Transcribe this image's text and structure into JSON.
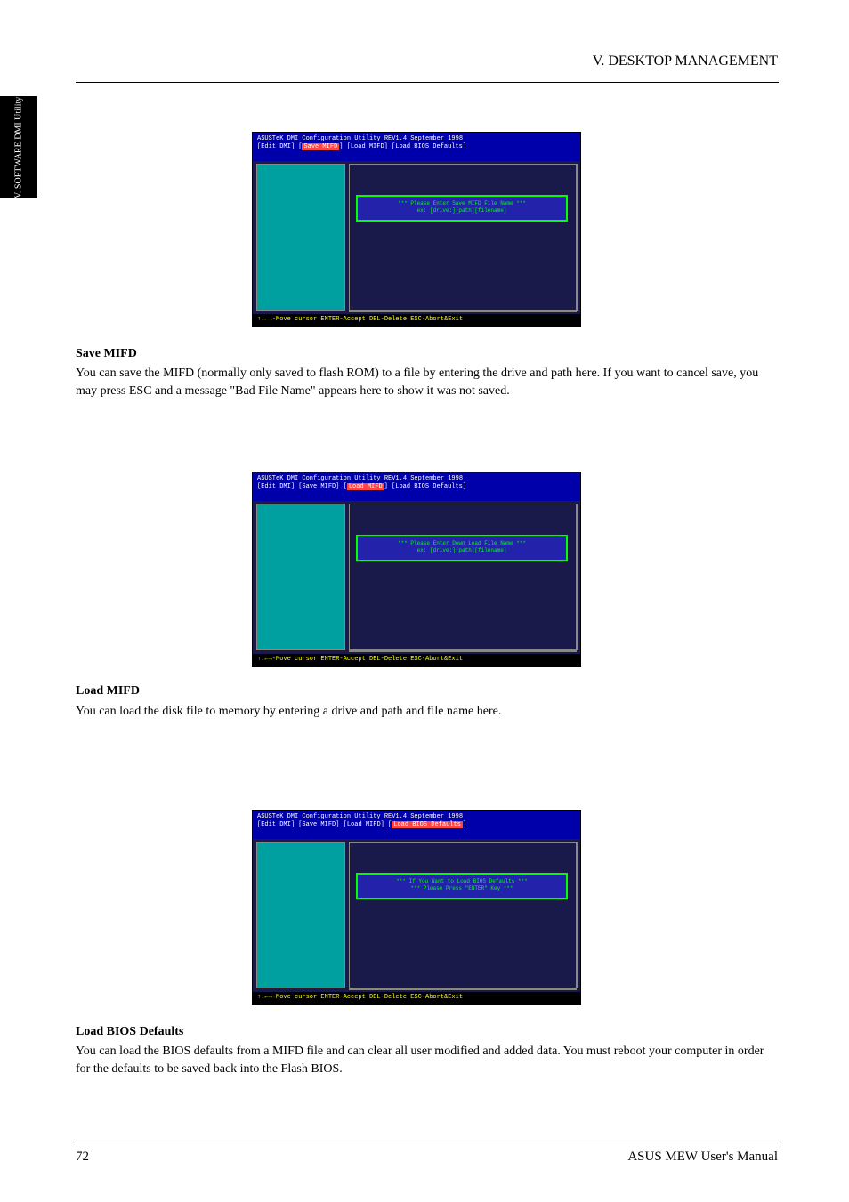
{
  "side_tab": "V. SOFTWARE\nDMI Utility",
  "header_title": "V. DESKTOP MANAGEMENT",
  "page_number": "72",
  "footer": "ASUS MEW User's Manual",
  "sections": [
    {
      "label": "Save MIFD",
      "desc": "You can save the MIFD (normally only saved to flash ROM) to a file by entering the drive and path here. If you want to cancel save, you may press ESC and a message \"Bad File Name\" appears here to show it was not saved."
    },
    {
      "label": "Load MIFD",
      "desc": "You can load the disk file to memory by entering a drive and path and file name here."
    },
    {
      "label": "Load BIOS Defaults",
      "desc": "You can load the BIOS defaults from a MIFD file and can clear all user modified and added data. You must reboot your computer in order for the defaults to be saved back into the Flash BIOS."
    }
  ],
  "screenshots": {
    "common_title": "ASUSTeK DMI Configuration Utility  REV1.4  September 1998",
    "menus": [
      "Edit DMI",
      "Save MIFD",
      "Load MIFD",
      "Load BIOS Defaults"
    ],
    "status_text": "↑↓←→-Move cursor  ENTER-Accept  DEL-Delete  ESC-Abort&Exit",
    "ss1": {
      "highlight_index": 1,
      "dialog_line1": "*** Please Enter Save MIFD File Name ***",
      "dialog_line2": "ex: [drive:][path][filename]"
    },
    "ss2": {
      "highlight_index": 2,
      "dialog_line1": "*** Please Enter Down Load File Name ***",
      "dialog_line2": "ex: [drive:][path][filename]"
    },
    "ss3": {
      "highlight_index": 3,
      "dialog_line1": "*** If You Want to Load BIOS Defaults ***",
      "dialog_line2": "*** Please Press \"ENTER\" Key ***"
    }
  }
}
